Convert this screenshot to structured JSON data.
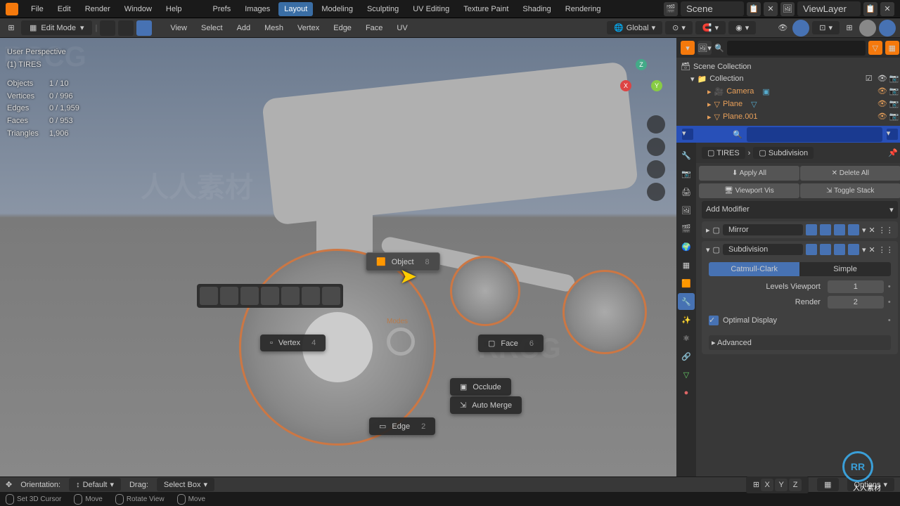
{
  "top_menu": {
    "items": [
      "File",
      "Edit",
      "Render",
      "Window",
      "Help"
    ],
    "workspace_tabs": [
      "Prefs",
      "Images",
      "Layout",
      "Modeling",
      "Sculpting",
      "UV Editing",
      "Texture Paint",
      "Shading",
      "Rendering"
    ],
    "active_workspace": "Layout",
    "scene_label": "Scene",
    "viewlayer_label": "ViewLayer"
  },
  "header": {
    "mode": "Edit Mode",
    "menus": [
      "View",
      "Select",
      "Add",
      "Mesh",
      "Vertex",
      "Edge",
      "Face",
      "UV"
    ],
    "orientation": "Global"
  },
  "viewport_stats": {
    "view_label": "User Perspective",
    "object_name": "(1) TIRES",
    "rows": [
      {
        "label": "Objects",
        "value": "1 / 10"
      },
      {
        "label": "Vertices",
        "value": "0 / 996"
      },
      {
        "label": "Edges",
        "value": "0 / 1,959"
      },
      {
        "label": "Faces",
        "value": "0 / 953"
      },
      {
        "label": "Triangles",
        "value": "1,906"
      }
    ]
  },
  "pie_menu": {
    "center_label": "Modes",
    "items": {
      "object": {
        "label": "Object",
        "key": "8"
      },
      "vertex": {
        "label": "Vertex",
        "key": "4"
      },
      "edge": {
        "label": "Edge",
        "key": "2"
      },
      "face": {
        "label": "Face",
        "key": "6"
      },
      "occlude": {
        "label": "Occlude"
      },
      "automerge": {
        "label": "Auto Merge"
      }
    }
  },
  "outliner": {
    "root": "Scene Collection",
    "collection": "Collection",
    "items": [
      "Camera",
      "Plane",
      "Plane.001"
    ]
  },
  "properties": {
    "breadcrumb_object": "TIRES",
    "breadcrumb_modifier": "Subdivision",
    "actions": {
      "apply": "Apply All",
      "delete": "Delete All",
      "viewport": "Viewport Vis",
      "toggle": "Toggle Stack"
    },
    "add_modifier": "Add Modifier",
    "modifiers": [
      {
        "name": "Mirror"
      },
      {
        "name": "Subdivision",
        "expanded": true
      }
    ],
    "subdivision": {
      "type_active": "Catmull-Clark",
      "type_other": "Simple",
      "levels_viewport_label": "Levels Viewport",
      "levels_viewport": "1",
      "render_label": "Render",
      "render": "2",
      "optimal_label": "Optimal Display",
      "advanced": "Advanced"
    }
  },
  "bottom": {
    "orientation_label": "Orientation:",
    "orientation_value": "Default",
    "drag_label": "Drag:",
    "drag_value": "Select Box",
    "axis": [
      "X",
      "Y",
      "Z"
    ],
    "options": "Options"
  },
  "status": {
    "items": [
      "Set 3D Cursor",
      "Move",
      "Rotate View",
      "Move"
    ]
  },
  "watermarks": [
    "RRCG",
    "人人素材"
  ],
  "chart_data": null
}
